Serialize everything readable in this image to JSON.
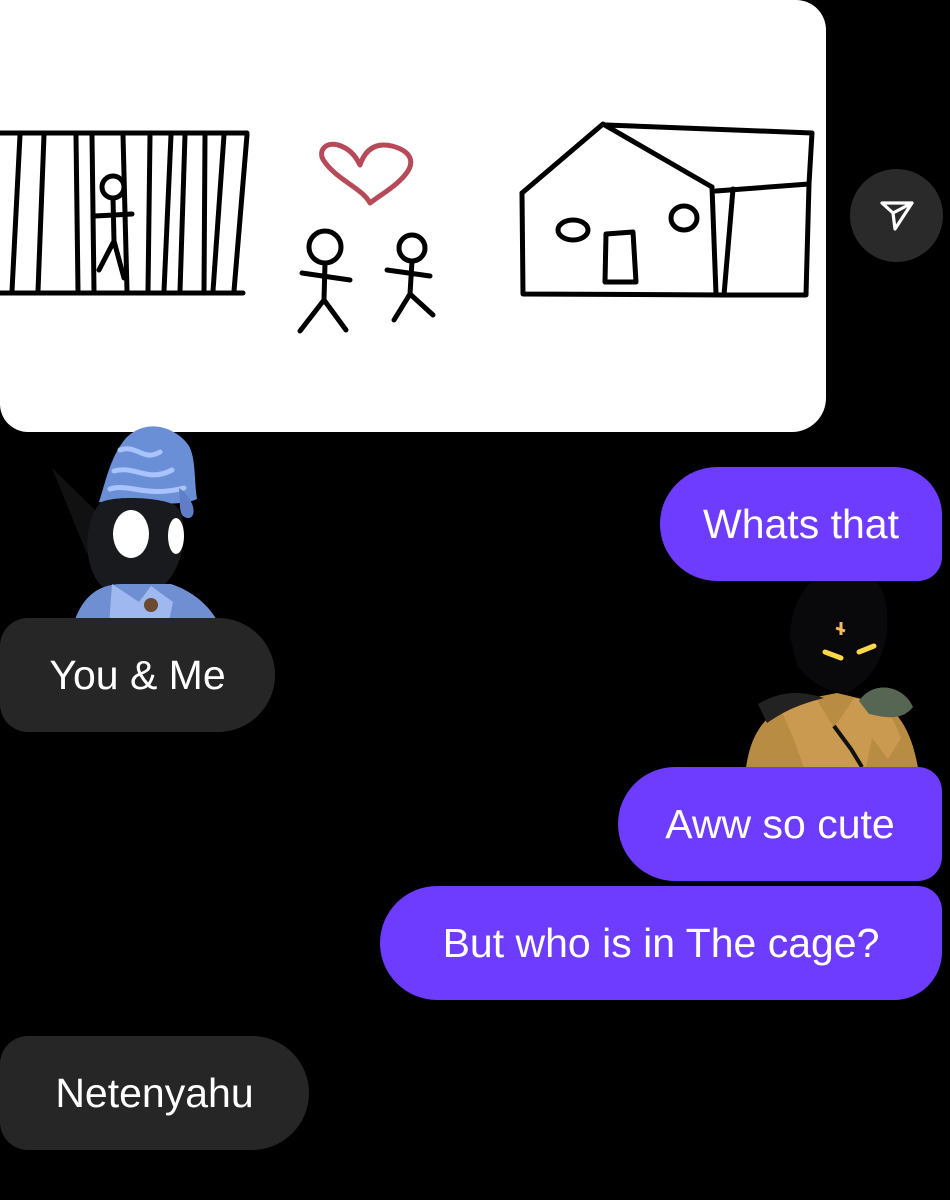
{
  "header": {
    "share_icon": "send-icon"
  },
  "messages": [
    {
      "side": "sent",
      "text": "Whats that"
    },
    {
      "side": "received",
      "text": "You & Me"
    },
    {
      "side": "sent",
      "text": "Aww so cute"
    },
    {
      "side": "sent",
      "text": "But who is in The cage?"
    },
    {
      "side": "received",
      "text": "Netenyahu"
    }
  ],
  "colors": {
    "background": "#000000",
    "sent_bubble": "#6d3cff",
    "received_bubble": "#262626",
    "text": "#ffffff",
    "drawing_ink": "#000000",
    "heart": "#b64a58"
  },
  "stickers": [
    {
      "name": "wizard-character-sticker"
    },
    {
      "name": "shadow-character-sticker"
    }
  ]
}
